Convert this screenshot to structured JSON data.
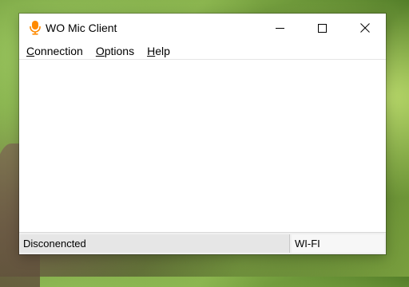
{
  "window": {
    "title": "WO Mic Client",
    "icon": "microphone-icon",
    "icon_color": "#ff8a00",
    "controls": [
      "minimize-icon",
      "maximize-icon",
      "close-icon"
    ]
  },
  "menu": [
    {
      "accel": "C",
      "rest": "onnection"
    },
    {
      "accel": "O",
      "rest": "ptions"
    },
    {
      "accel": "H",
      "rest": "elp"
    }
  ],
  "status": {
    "connection": "Disconencted",
    "transport": "WI-FI"
  }
}
